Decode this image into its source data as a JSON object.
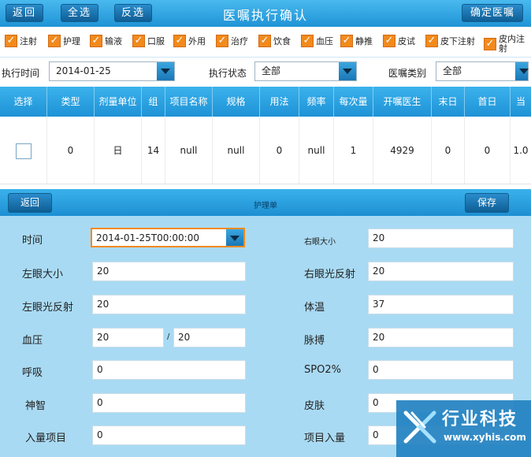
{
  "titlebar": {
    "back": "返回",
    "select_all": "全选",
    "invert": "反选",
    "title": "医嘱执行确认",
    "confirm": "确定医嘱"
  },
  "categories": [
    {
      "label": "注射",
      "checked": true
    },
    {
      "label": "护理",
      "checked": true
    },
    {
      "label": "输液",
      "checked": true
    },
    {
      "label": "口服",
      "checked": true
    },
    {
      "label": "外用",
      "checked": true
    },
    {
      "label": "治疗",
      "checked": true
    },
    {
      "label": "饮食",
      "checked": true
    },
    {
      "label": "血压",
      "checked": true
    },
    {
      "label": "静推",
      "checked": true
    },
    {
      "label": "皮试",
      "checked": true
    },
    {
      "label": "皮下注射",
      "checked": true
    },
    {
      "label": "皮内注射",
      "checked": true
    }
  ],
  "filters": {
    "time_label": "执行时间",
    "time_value": "2014-01-25",
    "status_label": "执行状态",
    "status_value": "全部",
    "type_label": "医嘱类别",
    "type_value": "全部"
  },
  "table": {
    "headers": [
      "选择",
      "类型",
      "剂量单位",
      "组",
      "项目名称",
      "规格",
      "用法",
      "频率",
      "每次量",
      "开嘱医生",
      "末日",
      "首日",
      "当"
    ],
    "row": [
      "",
      "0",
      "日",
      "14",
      "null",
      "null",
      "0",
      "null",
      "1",
      "4929",
      "0",
      "0",
      "1.0"
    ]
  },
  "nursing": {
    "back": "返回",
    "title": "护理单",
    "save": "保存",
    "time_label": "时间",
    "time_value": "2014-01-25T00:00:00",
    "right_eye_size_label": "右眼大小",
    "right_eye_size": "20",
    "left_eye_size_label": "左眼大小",
    "left_eye_size": "20",
    "right_eye_reflex_label": "右眼光反射",
    "right_eye_reflex": "20",
    "left_eye_reflex_label": "左眼光反射",
    "left_eye_reflex": "20",
    "temp_label": "体温",
    "temp": "37",
    "bp_label": "血压",
    "bp_high": "20",
    "bp_sep": "/",
    "bp_low": "20",
    "pulse_label": "脉搏",
    "pulse": "20",
    "resp_label": "呼吸",
    "resp": "0",
    "spo2_label": "SPO2%",
    "spo2": "0",
    "mind_label": "神智",
    "mind": "0",
    "skin_label": "皮肤",
    "skin": "0",
    "intake_label": "入量项目",
    "intake": "0",
    "intake_item_label": "项目入量",
    "intake_item": "0"
  },
  "watermark": {
    "name": "行业科技",
    "url": "www.xyhis.com"
  }
}
